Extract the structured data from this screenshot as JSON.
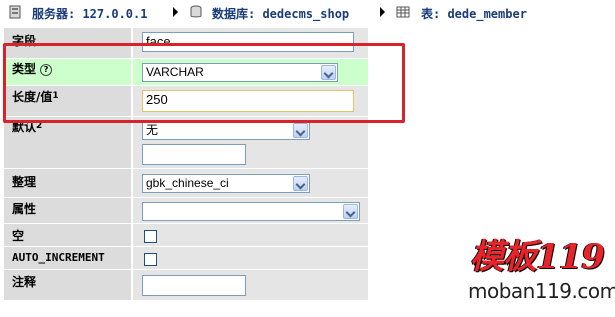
{
  "breadcrumb": {
    "server_label": "服务器: 127.0.0.1",
    "database_label": "数据库: dedecms_shop",
    "table_label": "表: dede_member"
  },
  "fields": {
    "field_label": "字段",
    "field_value": "face",
    "type_label": "类型",
    "type_value": "VARCHAR",
    "length_label": "长度/值",
    "length_sup": "1",
    "length_value": "250",
    "default_label": "默认",
    "default_sup": "2",
    "default_select_value": "无",
    "default_text_value": "",
    "collation_label": "整理",
    "collation_value": "gbk_chinese_ci",
    "attributes_label": "属性",
    "attributes_value": "",
    "null_label": "空",
    "auto_increment_label": "AUTO_INCREMENT",
    "comment_label": "注释",
    "comment_value": ""
  },
  "watermark": {
    "logo_text": "模板119",
    "url_text": "moban119.com"
  },
  "colors": {
    "highlight_row": "#ccffcc",
    "label_bg": "#dcdcdc",
    "value_bg": "#e5e5e5",
    "annotation_box": "#d8232a",
    "breadcrumb_text": "#1a3c7a"
  },
  "icons": [
    "server-icon",
    "database-icon",
    "table-icon",
    "help-icon",
    "dropdown-arrow-icon"
  ]
}
